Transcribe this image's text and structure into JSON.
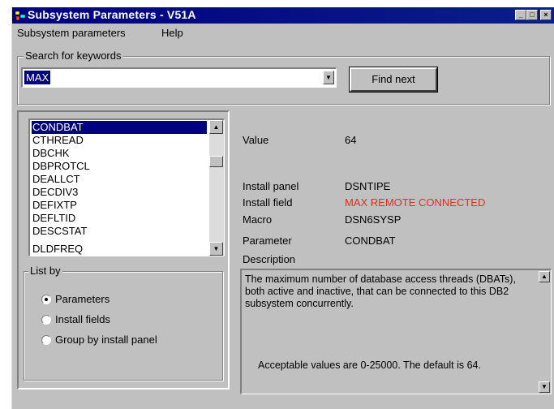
{
  "window": {
    "title": "Subsystem Parameters - V51A",
    "controls": [
      "minimize",
      "maximize",
      "close"
    ]
  },
  "menu": {
    "items": [
      "Subsystem parameters",
      "Help"
    ]
  },
  "search": {
    "group_label": "Search for keywords",
    "value": "MAX",
    "find_next_label": "Find next"
  },
  "parameter_list": {
    "items": [
      "CONDBAT",
      "CTHREAD",
      "DBCHK",
      "DBPROTCL",
      "DEALLCT",
      "DECDIV3",
      "DEFIXTP",
      "DEFLTID",
      "DESCSTAT",
      "DLDFREQ"
    ],
    "selected": "CONDBAT"
  },
  "list_by": {
    "label": "List by",
    "options": [
      "Parameters",
      "Install fields",
      "Group by install panel"
    ],
    "selected": "Parameters"
  },
  "details": {
    "value_label": "Value",
    "value": "64",
    "install_panel_label": "Install panel",
    "install_panel": "DSNTIPE",
    "install_field_label": "Install field",
    "install_field": "MAX REMOTE CONNECTED",
    "install_field_color": "#e03020",
    "macro_label": "Macro",
    "macro": "DSN6SYSP",
    "parameter_label": "Parameter",
    "parameter": "CONDBAT",
    "description_label": "Description",
    "description": "The maximum number of database access threads (DBATs), both active and inactive, that can be connected to this DB2 subsystem concurrently.",
    "acceptable_values": "Acceptable values are 0-25000.  The default is  64."
  }
}
